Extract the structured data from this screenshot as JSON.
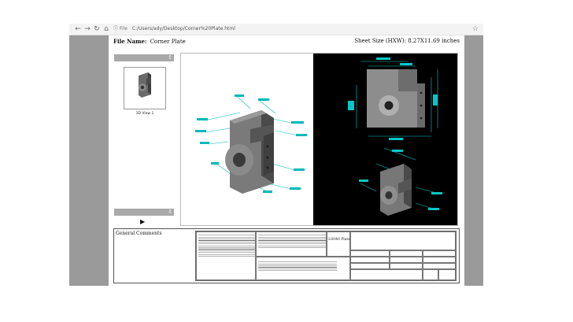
{
  "browser": {
    "back": "←",
    "forward": "→",
    "reload": "↻",
    "home": "⌂",
    "info": "ⓘ",
    "file_label": "File",
    "address": "C:/Users/ady/Desktop/Corner%20Plate.html",
    "star": "☆"
  },
  "header": {
    "file_name_label": "File Name:",
    "file_name": "Corner Plate",
    "sheet_size": "Sheet Size (HXW): 8.27X11.69 inches"
  },
  "sidebar": {
    "thumbnail_caption": "3D View 1",
    "up_arrow": "⇧",
    "down_arrow": "⇩",
    "play": "▶"
  },
  "bottom": {
    "comments_label": "General Comments",
    "material_name": "LS040 Plate"
  },
  "icons": {
    "back": "arrow-left-icon",
    "forward": "arrow-right-icon",
    "reload": "reload-icon",
    "home": "home-icon",
    "info": "info-icon",
    "star": "star-icon",
    "play": "play-icon"
  },
  "colors": {
    "stage": "#9a9a9a",
    "dimension": "#00c8c8",
    "viewer_dark": "#000000"
  }
}
